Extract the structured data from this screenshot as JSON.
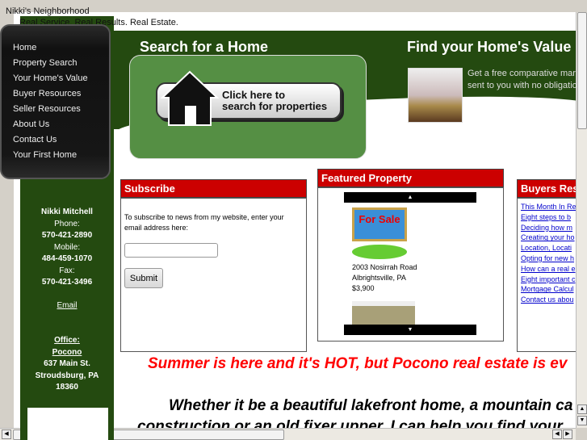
{
  "site": {
    "title": "Nikki's Neighborhood",
    "tagline": "Real Service. Real Results. Real Estate."
  },
  "menu": [
    "Home",
    "Property Search",
    "Your Home's Value",
    "Buyer Resources",
    "Seller Resources",
    "About Us",
    "Contact Us",
    "Your First Home"
  ],
  "search": {
    "heading": "Search for a Home",
    "button_line1": "Click here to",
    "button_line2": "search for properties"
  },
  "value": {
    "heading": "Find your Home's Value",
    "line1": "Get a free comparative mar",
    "line2": "sent to you with no obligatio"
  },
  "subscribe": {
    "heading": "Subscribe",
    "text": "To subscribe to news from my website, enter your email address here:",
    "email_value": "",
    "submit": "Submit"
  },
  "featured": {
    "heading": "Featured Property",
    "address": "2003 Nosirrah Road",
    "city": "Albrightsville, PA",
    "price": "$3,900",
    "sign_text": "For Sale"
  },
  "buyers": {
    "heading": "Buyers Res",
    "links": [
      "This Month In Re",
      "Eight steps to b",
      "Deciding how m",
      "Creating your ho",
      "Location, Locati",
      "Opting for new h",
      "How can a real e",
      "Eight important c",
      "Mortgage Calcul",
      "Contact us abou"
    ]
  },
  "contact": {
    "name": "Nikki Mitchell",
    "phone_label": "Phone:",
    "phone": "570-421-2890",
    "mobile_label": "Mobile:",
    "mobile": "484-459-1070",
    "fax_label": "Fax:",
    "fax": "570-421-3496",
    "email": "Email",
    "office_label": "Office:",
    "office_name": "Pocono",
    "street": "637 Main St.",
    "city": "Stroudsburg, PA",
    "zip": "18360"
  },
  "body": {
    "summer": "Summer is here and it's HOT, but Pocono real estate is ev",
    "whether": "Whether it be a beautiful lakefront home, a mountain ca",
    "construction": "construction or an old fixer upper, I can help you find your"
  },
  "colors": {
    "green_dark": "#244a10",
    "green_box": "#558f44",
    "red_header": "#cc0000",
    "link": "#0000cc"
  }
}
